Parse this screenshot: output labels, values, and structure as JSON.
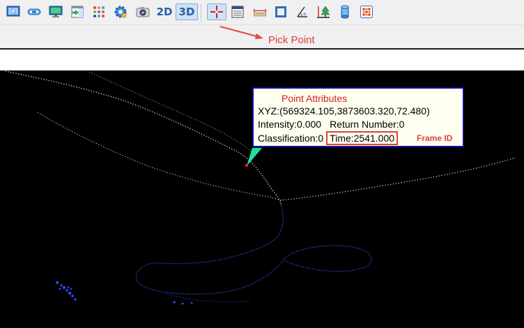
{
  "toolbar": {
    "buttons": [
      {
        "name": "select-tool",
        "icon": "cursor-screen-icon"
      },
      {
        "name": "link-tool",
        "icon": "link-chain-icon"
      },
      {
        "name": "monitor-tool",
        "icon": "monitor-icon"
      },
      {
        "name": "import-tool",
        "icon": "arrow-window-icon"
      },
      {
        "name": "palette-tool",
        "icon": "color-dots-icon"
      },
      {
        "name": "settings-tool",
        "icon": "gear-icon"
      },
      {
        "name": "camera-tool",
        "icon": "camera-icon"
      }
    ],
    "view_2d_label": "2D",
    "view_3d_label": "3D",
    "measure_buttons": [
      {
        "name": "pick-point-tool",
        "icon": "crosshair-icon"
      },
      {
        "name": "attribute-table-tool",
        "icon": "table-icon"
      },
      {
        "name": "distance-tool",
        "icon": "ruler-icon"
      },
      {
        "name": "area-tool",
        "icon": "square-frame-icon"
      },
      {
        "name": "angle-tool",
        "icon": "angle-icon"
      },
      {
        "name": "height-tool",
        "icon": "tree-height-icon"
      },
      {
        "name": "volume-tool",
        "icon": "cylinder-icon"
      },
      {
        "name": "point-grid-tool",
        "icon": "point-grid-icon"
      }
    ]
  },
  "annotations": {
    "pick_point": "Pick Point",
    "frame_id": "Frame ID",
    "annotation_color": "#e04040"
  },
  "popup": {
    "title": "Point Attributes",
    "xyz": "XYZ:(569324.105,3873603.320,72.480)",
    "intensity": "Intensity:0.000",
    "return_number": "Return Number:0",
    "classification": "Classification:0",
    "time": "Time:2541.000",
    "border_color": "#1010a0",
    "pointer_color": "#20e0a0"
  },
  "colors": {
    "point_cloud": "#d8d8d8",
    "water_points": "#2040ff",
    "picked_point": "#ff2020",
    "active_button": "#cfe2f7"
  }
}
